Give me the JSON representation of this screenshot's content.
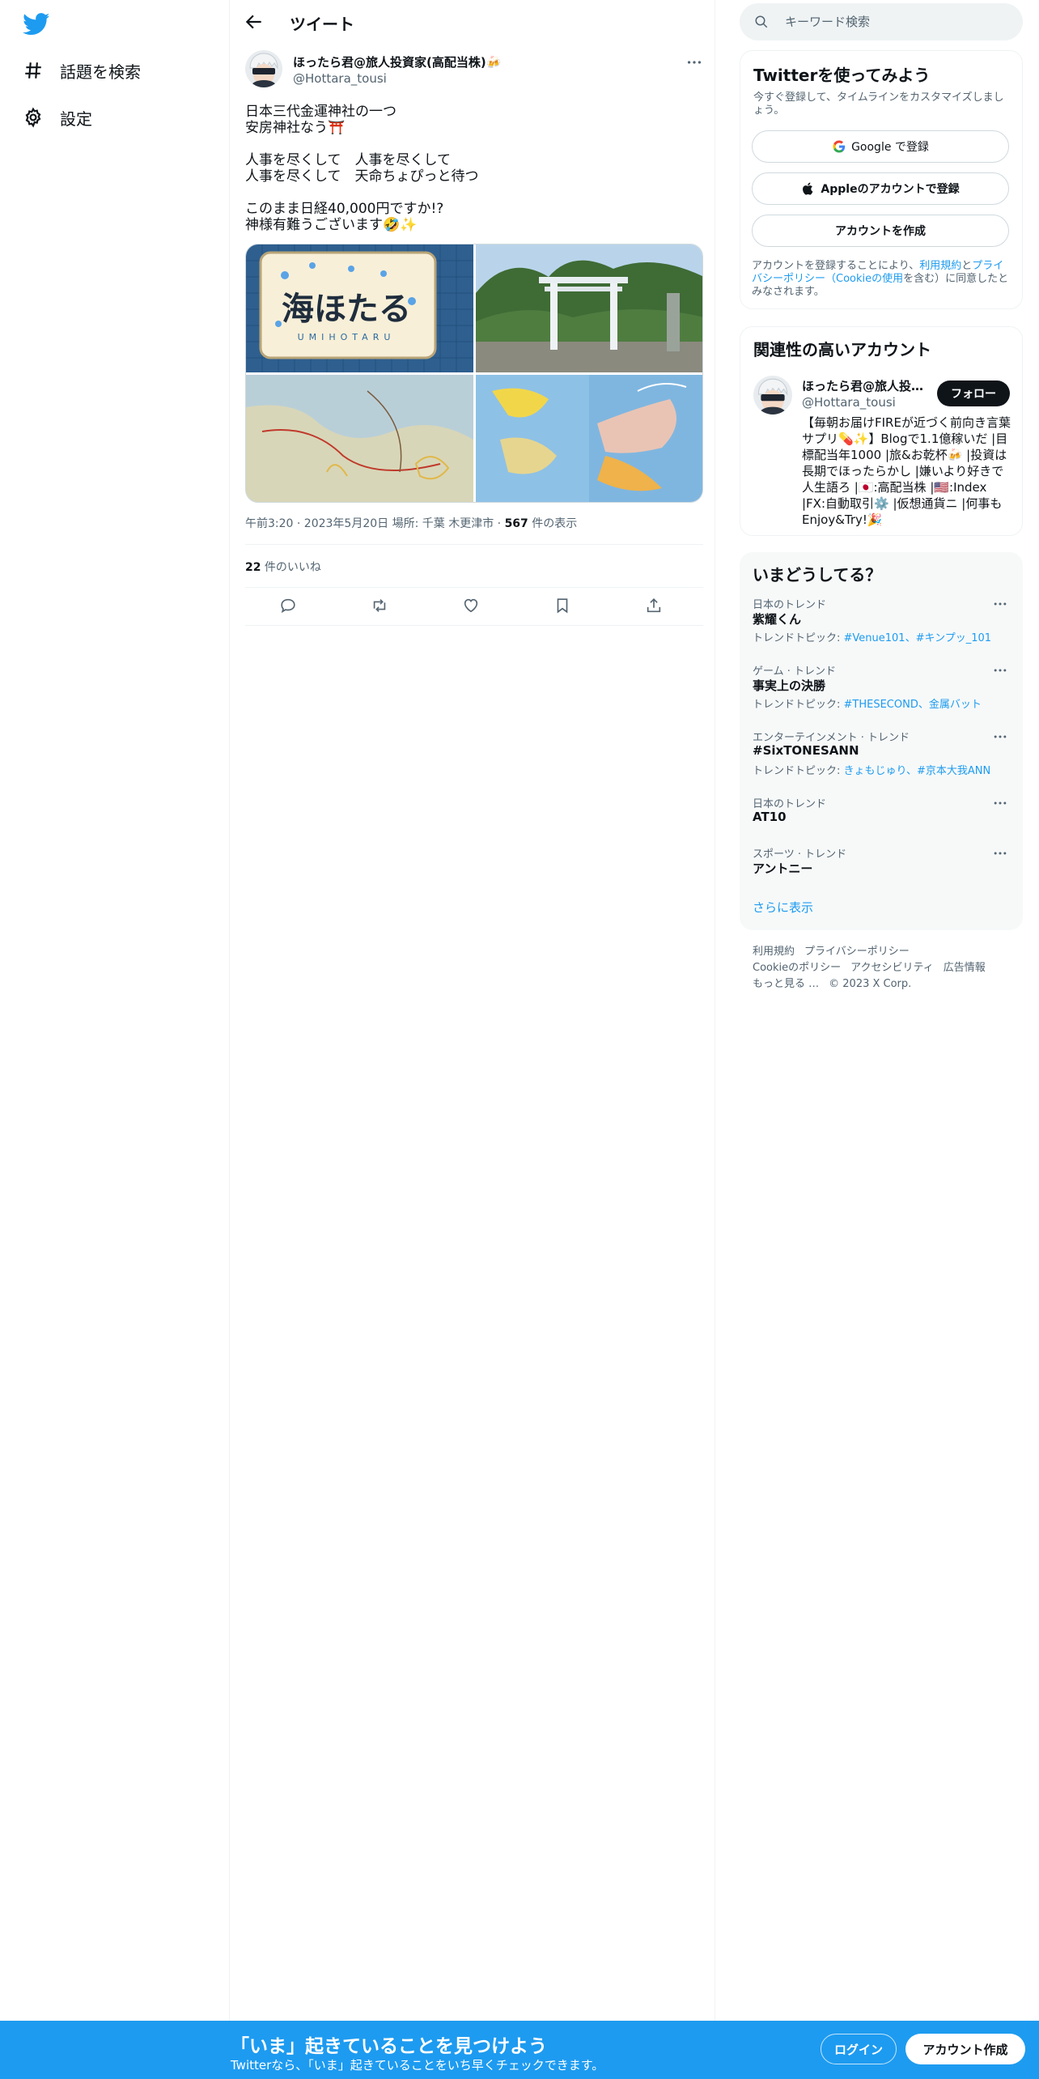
{
  "colors": {
    "brand": "#1d9bf0",
    "text": "#0f1419",
    "secondary": "#536471"
  },
  "sidebar": {
    "logo_icon": "twitter-bird-icon",
    "items": [
      {
        "icon": "hashtag-icon",
        "label": "話題を検索"
      },
      {
        "icon": "gear-icon",
        "label": "設定"
      }
    ]
  },
  "header": {
    "back_icon": "arrow-left-icon",
    "title": "ツイート"
  },
  "tweet": {
    "author_name": "ほったら君@旅人投資家(高配当株)🍻",
    "author_handle": "@Hottara_tousi",
    "text_lines": [
      "日本三代金運神社の一つ",
      "安房神社なう⛩️",
      "",
      "人事を尽くして　人事を尽くして",
      "人事を尽くして　天命ちょぴっと待つ",
      "",
      "このまま日経40,000円ですか!?",
      "神様有難うございます🤣✨"
    ],
    "images": [
      {
        "subject": "umihotaru-sign",
        "sign_text": "海ほたる",
        "sign_sub": "UMIHOTARU"
      },
      {
        "subject": "torii-gate"
      },
      {
        "subject": "japan-map"
      },
      {
        "subject": "japan-map-colored"
      }
    ],
    "meta_time": "午前3:20 · 2023年5月20日 場所: 千葉 木更津市 · ",
    "views_count": "567",
    "views_label": " 件の表示",
    "likes_count": "22",
    "likes_label": " 件のいいね",
    "actions": [
      "reply-icon",
      "retweet-icon",
      "like-icon",
      "bookmark-icon",
      "share-icon"
    ]
  },
  "search": {
    "placeholder": "キーワード検索"
  },
  "signup": {
    "title": "Twitterを使ってみよう",
    "subtitle": "今すぐ登録して、タイムラインをカスタマイズしましょう。",
    "google_label": "Google で登録",
    "apple_label": "Appleのアカウントで登録",
    "create_label": "アカウントを作成",
    "terms_pre": "アカウントを登録することにより、",
    "terms_link1": "利用規約",
    "terms_mid": "と",
    "terms_link2": "プライバシーポリシー（Cookieの使用",
    "terms_post": "を含む）に同意したとみなされます。"
  },
  "related": {
    "title": "関連性の高いアカウント",
    "name": "ほったら君@旅人投資家(高配当株)🍻",
    "handle": "@Hottara_tousi",
    "follow_label": "フォロー",
    "bio": "【毎朝お届けFIREが近づく前向き言葉サプリ💊✨】Blogで1.1億稼いだ |目標配当年1000 |旅&お乾杯🍻 |投資は長期でほったらかし |嫌いより好きで人生語ろ |🇯🇵:高配当株 |🇺🇸:Index |FX:自動取引⚙️ |仮想通貨ニ |何事もEnjoy&Try!🎉"
  },
  "trends": {
    "title": "いまどうしてる？",
    "items": [
      {
        "context": "日本のトレンド",
        "name": "紫耀くん",
        "topics_label": "トレンドトピック: ",
        "topics": "#Venue101、#キンプッ_101"
      },
      {
        "context": "ゲーム · トレンド",
        "name": "事実上の決勝",
        "topics_label": "トレンドトピック: ",
        "topics": "#THESECOND、金属バット"
      },
      {
        "context": "エンターテインメント · トレンド",
        "name": "#SixTONESANN",
        "topics_label": "トレンドトピック: ",
        "topics": "きょもじゅり、#京本大我ANN"
      },
      {
        "context": "日本のトレンド",
        "name": "AT10",
        "topics_label": "",
        "topics": ""
      },
      {
        "context": "スポーツ · トレンド",
        "name": "アントニー",
        "topics_label": "",
        "topics": ""
      }
    ],
    "show_more": "さらに表示"
  },
  "footer": {
    "links": [
      "利用規約",
      "プライバシーポリシー",
      "Cookieのポリシー",
      "アクセシビリティ",
      "広告情報",
      "もっと見る …"
    ],
    "copyright": "© 2023 X Corp."
  },
  "bottom_bar": {
    "title": "「いま」起きていることを見つけよう",
    "subtitle": "Twitterなら、「いま」起きていることをいち早くチェックできます。",
    "login_label": "ログイン",
    "signup_label": "アカウント作成"
  }
}
